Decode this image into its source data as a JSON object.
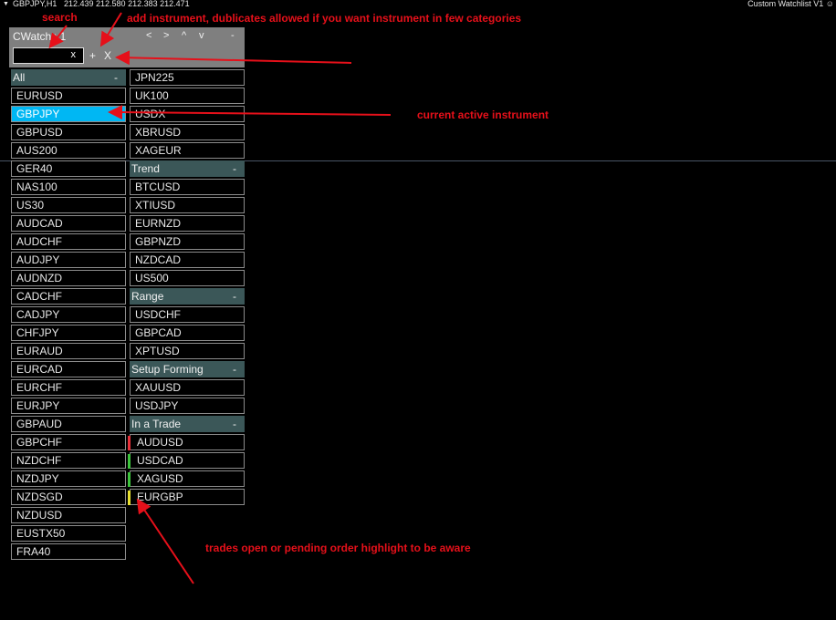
{
  "chart_header": {
    "symbol": "GBPJPY,H1",
    "prices": "212.439 212.580 212.383 212.471",
    "indicator": "Custom Watchlist V1"
  },
  "panel": {
    "title": "CWatch v1",
    "nav": [
      "<",
      ">",
      "^",
      "v",
      "-"
    ],
    "search_clear": "x",
    "add_label": "+",
    "remove_label": "X"
  },
  "categories": {
    "all": {
      "name": "All",
      "collapse": "-",
      "items": [
        "EURUSD",
        "GBPJPY",
        "GBPUSD",
        "AUS200",
        "GER40",
        "NAS100",
        "US30",
        "AUDCAD",
        "AUDCHF",
        "AUDJPY",
        "AUDNZD",
        "CADCHF",
        "CADJPY",
        "CHFJPY",
        "EURAUD",
        "EURCAD",
        "EURCHF",
        "EURJPY",
        "GBPAUD",
        "GBPCHF",
        "NZDCHF",
        "NZDJPY",
        "NZDSGD",
        "NZDUSD",
        "EUSTX50",
        "FRA40"
      ],
      "active": "GBPJPY"
    },
    "top": {
      "items": [
        "JPN225",
        "UK100",
        "USDX",
        "XBRUSD",
        "XAGEUR"
      ]
    },
    "trend": {
      "name": "Trend",
      "collapse": "-",
      "items": [
        "BTCUSD",
        "XTIUSD",
        "EURNZD",
        "GBPNZD",
        "NZDCAD",
        "US500"
      ]
    },
    "range": {
      "name": "Range",
      "collapse": "-",
      "items": [
        "USDCHF",
        "GBPCAD",
        "XPTUSD"
      ]
    },
    "setup": {
      "name": "Setup Forming",
      "collapse": "-",
      "items": [
        "XAUUSD",
        "USDJPY"
      ]
    },
    "trade": {
      "name": "In a Trade",
      "collapse": "-",
      "items": [
        {
          "symbol": "AUDUSD",
          "color": "#e8303a"
        },
        {
          "symbol": "USDCAD",
          "color": "#3cc43c"
        },
        {
          "symbol": "XAGUSD",
          "color": "#3cc43c"
        },
        {
          "symbol": "EURGBP",
          "color": "#e8e030"
        }
      ]
    }
  },
  "annotations": {
    "search": "search",
    "add": "add instrument, dublicates allowed if you want instrument in few categories",
    "active": "current active instrument",
    "trades": "trades open or pending order highlight to be aware"
  },
  "colors": {
    "active_bg": "#00b7f3",
    "header_bg": "#3b5758",
    "annotation": "#e6101a"
  }
}
